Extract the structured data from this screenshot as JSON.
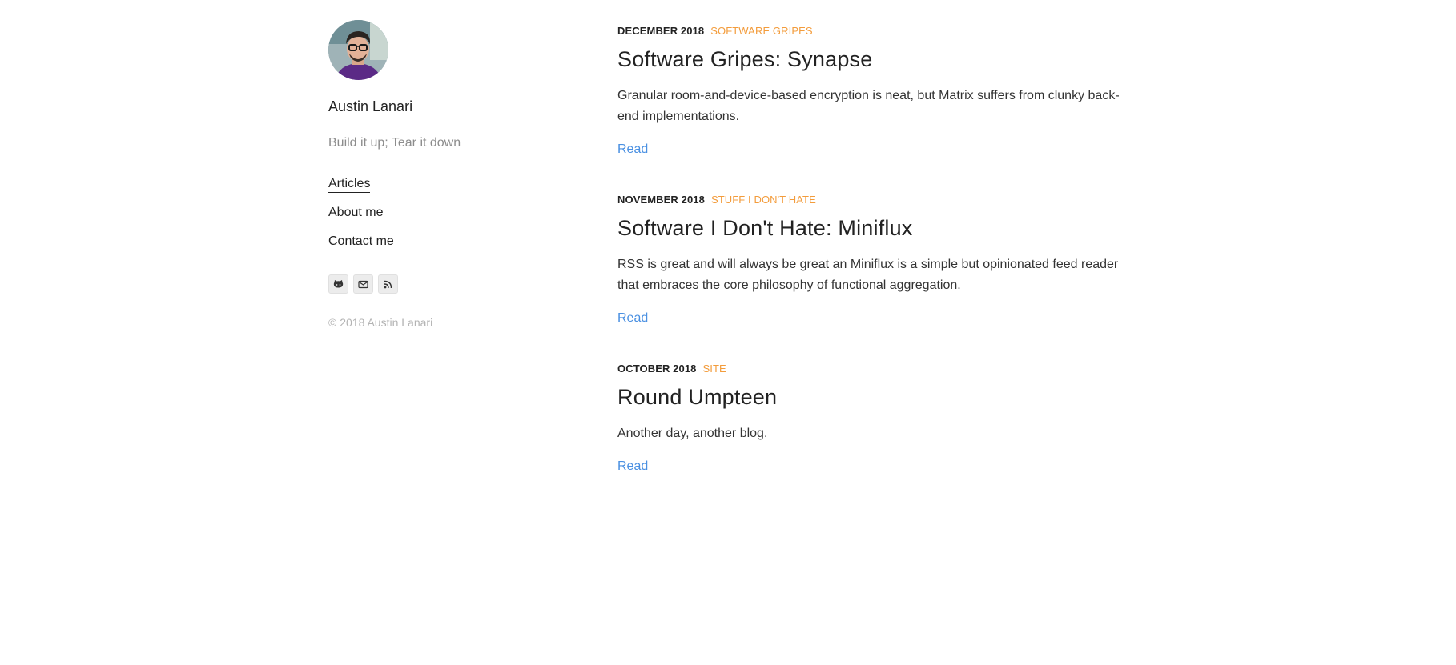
{
  "sidebar": {
    "avatar_alt": "Austin Lanari",
    "site_name": "Austin Lanari",
    "tagline": "Build it up; Tear it down",
    "nav": [
      {
        "label": "Articles",
        "active": true
      },
      {
        "label": "About me",
        "active": false
      },
      {
        "label": "Contact me",
        "active": false
      }
    ],
    "socials": [
      {
        "icon": "github-icon"
      },
      {
        "icon": "email-icon"
      },
      {
        "icon": "rss-icon"
      }
    ],
    "copyright": "© 2018 Austin Lanari"
  },
  "posts": [
    {
      "date": "DECEMBER 2018",
      "category": "SOFTWARE GRIPES",
      "title": "Software Gripes: Synapse",
      "summary": "Granular room-and-device-based encryption is neat, but Matrix suffers from clunky back-end implementations.",
      "read_label": "Read"
    },
    {
      "date": "NOVEMBER 2018",
      "category": "STUFF I DON'T HATE",
      "title": "Software I Don't Hate: Miniflux",
      "summary": "RSS is great and will always be great an Miniflux is a simple but opinionated feed reader that embraces the core philosophy of functional aggregation.",
      "read_label": "Read"
    },
    {
      "date": "OCTOBER 2018",
      "category": "SITE",
      "title": "Round Umpteen",
      "summary": "Another day, another blog.",
      "read_label": "Read"
    }
  ],
  "colors": {
    "accent_category": "#f39c3c",
    "link": "#4a90e2",
    "muted": "#8c8c8c"
  }
}
